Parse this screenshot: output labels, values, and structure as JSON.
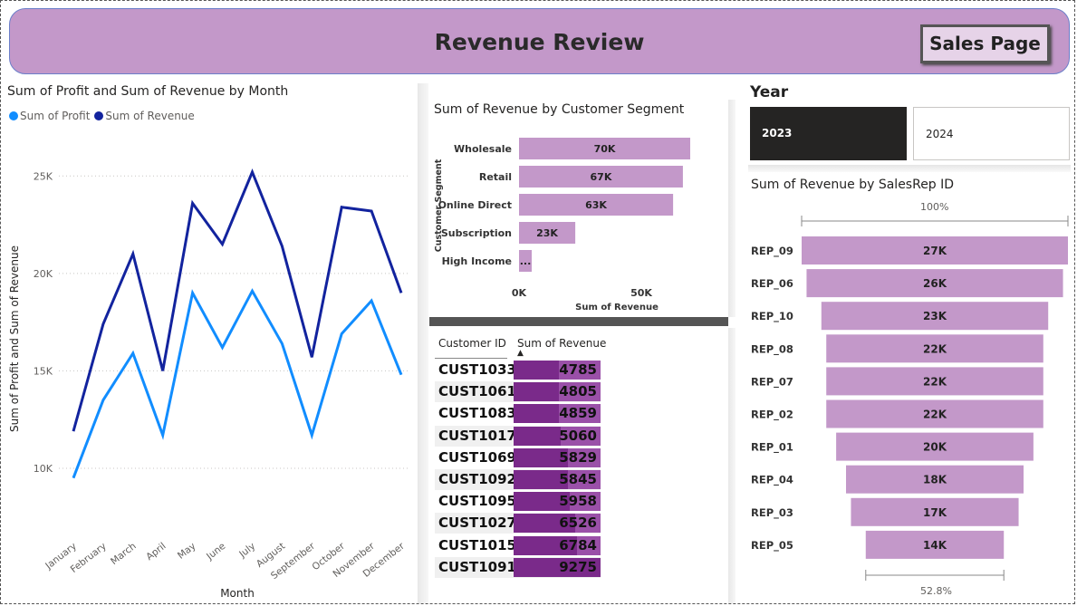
{
  "header": {
    "title": "Revenue Review",
    "sales_button": "Sales Page"
  },
  "colors": {
    "banner": "#c398c9",
    "profit": "#118dff",
    "revenue": "#12239e",
    "bar": "#c398c9",
    "table_bar": "#7a2a8a"
  },
  "line_chart": {
    "title": "Sum of Profit and Sum of Revenue by Month",
    "legend": [
      "Sum of Profit",
      "Sum of Revenue"
    ],
    "xlabel": "Month",
    "ylabel": "Sum of Profit and Sum of Revenue",
    "yticks": [
      "25K",
      "20K",
      "15K",
      "10K"
    ]
  },
  "segment_chart": {
    "title": "Sum of Revenue by Customer Segment",
    "ylabel": "Customer Segment",
    "xlabel": "Sum of Revenue",
    "xticks": [
      "0K",
      "50K"
    ]
  },
  "table": {
    "col1": "Customer ID",
    "col2": "Sum of Revenue",
    "rows": [
      {
        "id": "CUST1033",
        "value": "4785"
      },
      {
        "id": "CUST1061",
        "value": "4805"
      },
      {
        "id": "CUST1083",
        "value": "4859"
      },
      {
        "id": "CUST1017",
        "value": "5060"
      },
      {
        "id": "CUST1069",
        "value": "5829"
      },
      {
        "id": "CUST1092",
        "value": "5845"
      },
      {
        "id": "CUST1095",
        "value": "5958"
      },
      {
        "id": "CUST1027",
        "value": "6526"
      },
      {
        "id": "CUST1015",
        "value": "6784"
      },
      {
        "id": "CUST1091",
        "value": "9275"
      }
    ]
  },
  "year_slicer": {
    "title": "Year",
    "options": [
      "2023",
      "2024"
    ],
    "selected": "2023"
  },
  "funnel": {
    "title": "Sum of Revenue by SalesRep ID",
    "top_pct": "100%",
    "bottom_pct": "52.8%"
  },
  "chart_data": [
    {
      "type": "line",
      "title": "Sum of Profit and Sum of Revenue by Month",
      "xlabel": "Month",
      "ylabel": "Sum of Profit and Sum of Revenue",
      "categories": [
        "January",
        "February",
        "March",
        "April",
        "May",
        "June",
        "July",
        "August",
        "September",
        "October",
        "November",
        "December"
      ],
      "ylim": [
        8000,
        26500
      ],
      "series": [
        {
          "name": "Sum of Profit",
          "values": [
            9500,
            13500,
            15900,
            11700,
            19000,
            16200,
            19100,
            16400,
            11700,
            16900,
            18600,
            14800
          ]
        },
        {
          "name": "Sum of Revenue",
          "values": [
            11900,
            17400,
            21000,
            15000,
            23600,
            21500,
            25200,
            21400,
            15700,
            23400,
            23200,
            19000
          ]
        }
      ],
      "grid": true,
      "legend": "top-left"
    },
    {
      "type": "bar",
      "orientation": "horizontal",
      "title": "Sum of Revenue by Customer Segment",
      "xlabel": "Sum of Revenue",
      "ylabel": "Customer Segment",
      "categories": [
        "Wholesale",
        "Retail",
        "Online Direct",
        "Subscription",
        "High Income"
      ],
      "values": [
        70000,
        67000,
        63000,
        23000,
        5000
      ],
      "labels": [
        "70K",
        "67K",
        "63K",
        "23K",
        "..."
      ],
      "xlim": [
        0,
        70000
      ]
    },
    {
      "type": "table",
      "columns": [
        "Customer ID",
        "Sum of Revenue"
      ],
      "rows": [
        [
          "CUST1033",
          4785
        ],
        [
          "CUST1061",
          4805
        ],
        [
          "CUST1083",
          4859
        ],
        [
          "CUST1017",
          5060
        ],
        [
          "CUST1069",
          5829
        ],
        [
          "CUST1092",
          5845
        ],
        [
          "CUST1095",
          5958
        ],
        [
          "CUST1027",
          6526
        ],
        [
          "CUST1015",
          6784
        ],
        [
          "CUST1091",
          9275
        ]
      ]
    },
    {
      "type": "bar",
      "subtype": "funnel",
      "title": "Sum of Revenue by SalesRep ID",
      "categories": [
        "REP_09",
        "REP_06",
        "REP_10",
        "REP_08",
        "REP_07",
        "REP_02",
        "REP_01",
        "REP_04",
        "REP_03",
        "REP_05"
      ],
      "values": [
        27000,
        26000,
        23000,
        22000,
        22000,
        22000,
        20000,
        18000,
        17000,
        14000
      ],
      "labels": [
        "27K",
        "26K",
        "23K",
        "22K",
        "22K",
        "22K",
        "20K",
        "18K",
        "17K",
        "14K"
      ]
    }
  ]
}
